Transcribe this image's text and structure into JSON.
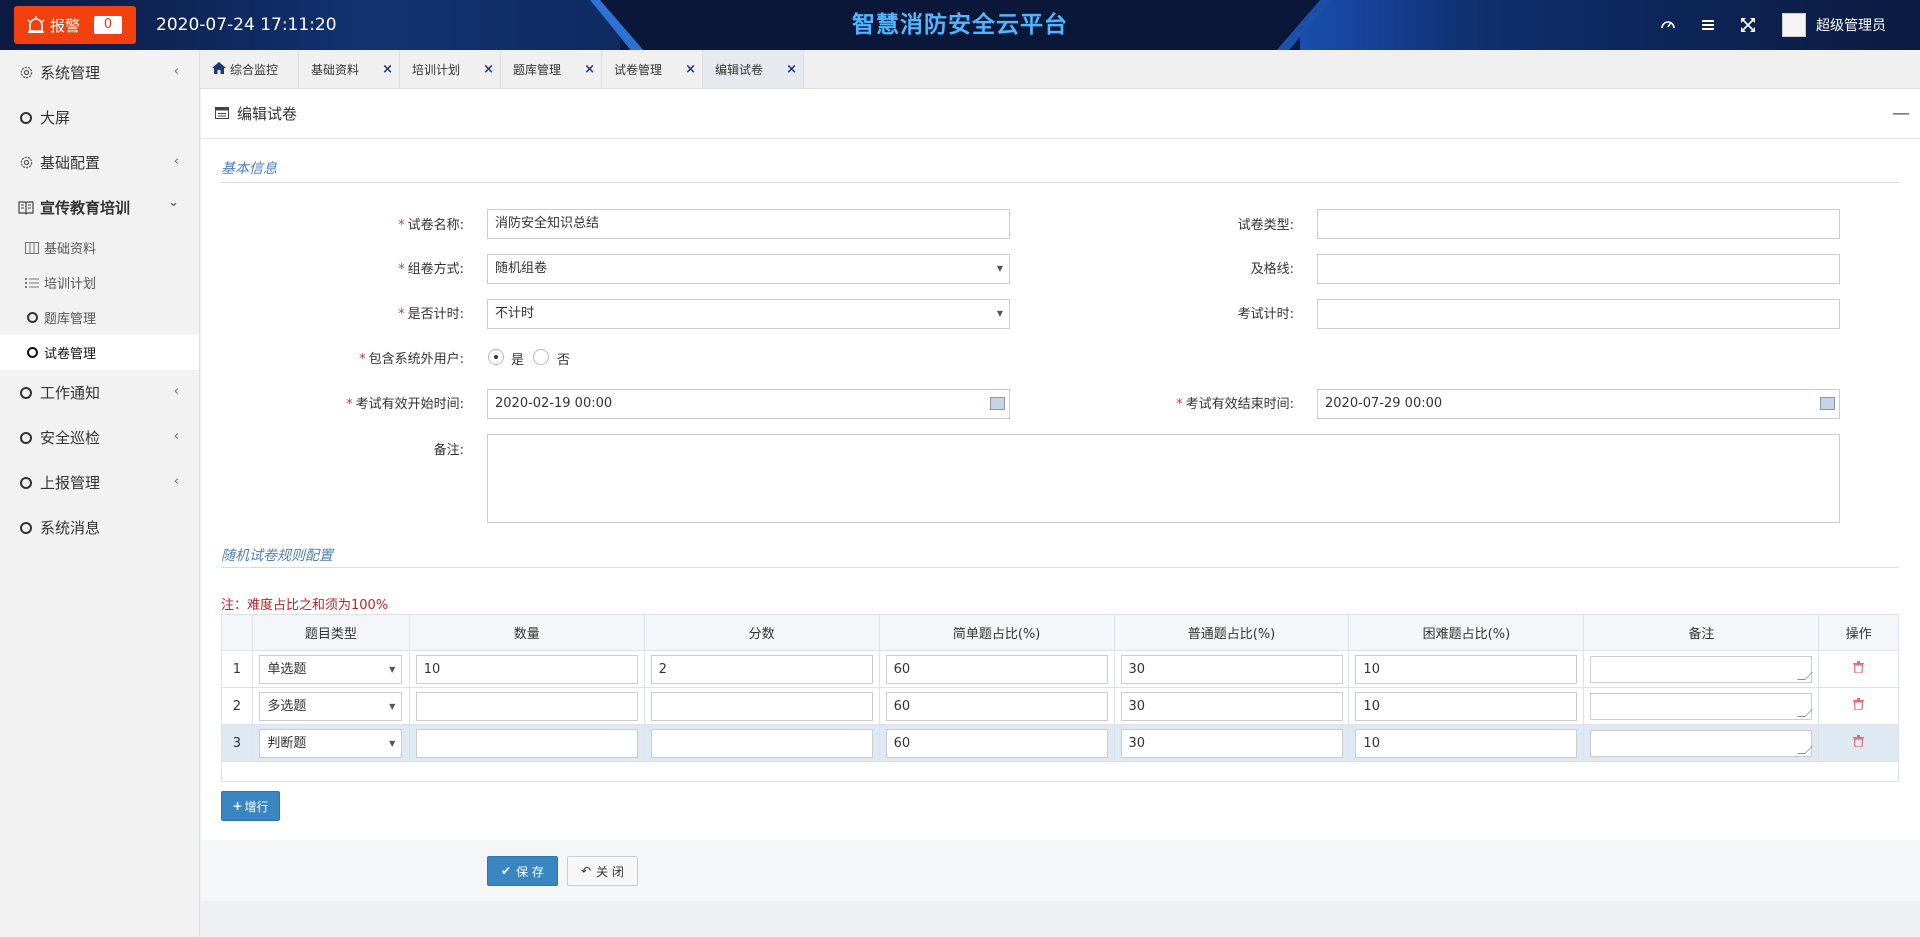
{
  "header": {
    "alarm_label": "报警",
    "alarm_count": "0",
    "datetime": "2020-07-24 17:11:20",
    "title": "智慧消防安全云平台",
    "username": "超级管理员",
    "icons": [
      "dashboard-icon",
      "menu-icon",
      "fullscreen-icon",
      "avatar"
    ]
  },
  "sidebar": {
    "items": [
      {
        "label": "系统管理",
        "icon": "gear-icon",
        "arrow": "‹"
      },
      {
        "label": "大屏",
        "icon": "circle-icon"
      },
      {
        "label": "基础配置",
        "icon": "gear-icon",
        "arrow": "‹"
      },
      {
        "label": "宣传教育培训",
        "icon": "book-icon",
        "arrow": "⌄"
      },
      {
        "label": "工作通知",
        "icon": "circle-icon",
        "arrow": "‹"
      },
      {
        "label": "安全巡检",
        "icon": "circle-icon",
        "arrow": "‹"
      },
      {
        "label": "上报管理",
        "icon": "circle-icon",
        "arrow": "‹"
      },
      {
        "label": "系统消息",
        "icon": "circle-icon"
      }
    ],
    "subitems": [
      {
        "label": "基础资料",
        "icon": "columns-icon"
      },
      {
        "label": "培训计划",
        "icon": "list-icon"
      },
      {
        "label": "题库管理",
        "icon": "circle-icon"
      },
      {
        "label": "试卷管理",
        "icon": "circle-icon"
      }
    ]
  },
  "tabs": [
    {
      "label": "综合监控"
    },
    {
      "label": "基础资料",
      "close": "×"
    },
    {
      "label": "培训计划",
      "close": "×"
    },
    {
      "label": "题库管理",
      "close": "×"
    },
    {
      "label": "试卷管理",
      "close": "×"
    },
    {
      "label": "编辑试卷",
      "close": "×"
    }
  ],
  "panel": {
    "title": "编辑试卷",
    "collapse": "—",
    "section_basic": "基本信息",
    "section_rules": "随机试卷规则配置",
    "note": "注：难度占比之和须为100%"
  },
  "form": {
    "req": "*",
    "name_label": "试卷名称:",
    "name_value": "消防安全知识总结",
    "type_label": "试卷类型:",
    "type_value": "",
    "compose_label": "组卷方式:",
    "compose_value": "随机组卷",
    "pass_label": "及格线:",
    "pass_value": "",
    "timed_label": "是否计时:",
    "timed_value": "不计时",
    "duration_label": "考试计时:",
    "duration_value": "",
    "external_label": "包含系统外用户:",
    "external_yes": "是",
    "external_no": "否",
    "start_label": "考试有效开始时间:",
    "start_value": "2020-02-19 00:00",
    "end_label": "考试有效结束时间:",
    "end_value": "2020-07-29 00:00",
    "remark_label": "备注:",
    "remark_value": ""
  },
  "rule_table": {
    "headers": [
      "",
      "题目类型",
      "数量",
      "分数",
      "简单题占比(%)",
      "普通题占比(%)",
      "困难题占比(%)",
      "备注",
      "操作"
    ],
    "rows": [
      {
        "no": "1",
        "type": "单选题",
        "count": "10",
        "score": "2",
        "easy": "60",
        "normal": "30",
        "hard": "10",
        "remark": ""
      },
      {
        "no": "2",
        "type": "多选题",
        "count": "",
        "score": "",
        "easy": "60",
        "normal": "30",
        "hard": "10",
        "remark": ""
      },
      {
        "no": "3",
        "type": "判断题",
        "count": "",
        "score": "",
        "easy": "60",
        "normal": "30",
        "hard": "10",
        "remark": ""
      }
    ]
  },
  "buttons": {
    "add_row": "增行",
    "save": "保 存",
    "close": "关 闭"
  },
  "colors": {
    "accent": "#3a86c2",
    "alarm": "#f2400f",
    "title": "#4fb6ff",
    "required": "#d33333"
  }
}
